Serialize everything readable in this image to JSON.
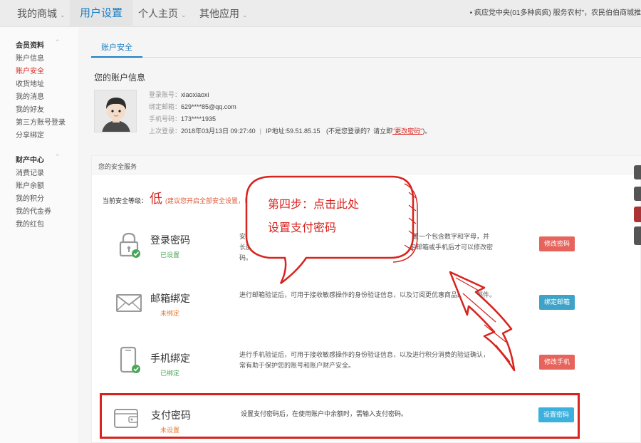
{
  "topnav": {
    "items": [
      {
        "label": "我的商城",
        "caret": "⌄"
      },
      {
        "label": "用户设置"
      },
      {
        "label": "个人主页",
        "caret": "⌄"
      },
      {
        "label": "其他应用",
        "caret": "⌄"
      }
    ],
    "notice": "• 疯应党中央(01多种疯疯) 服务农村\"，农民伯伯商城推"
  },
  "sidebar": {
    "group1": {
      "title": "会员资料",
      "fold": "⌃",
      "items": [
        "账户信息",
        "账户安全",
        "收货地址",
        "我的消息",
        "我的好友",
        "第三方账号登录",
        "分享绑定"
      ]
    },
    "group2": {
      "title": "财产中心",
      "fold": "⌃",
      "items": [
        "消费记录",
        "账户余额",
        "我的积分",
        "我的代金券",
        "我的红包"
      ]
    }
  },
  "main": {
    "tab": "账户安全",
    "info_title": "您的账户信息",
    "account": {
      "login_label": "登录账号：",
      "login_value": "xiaoxiaoxi",
      "email_label": "绑定邮箱：",
      "email_value": "629****85@qq.com",
      "phone_label": "手机号码：",
      "phone_value": "173****1935",
      "last_login_label": "上次登录：",
      "last_login_value": "2018年03月13日 09:27:40",
      "ip_sep": "|",
      "ip_label": "IP地址:",
      "ip_value": "59.51.85.15",
      "warn_pre": "(不是您登录的？请立即",
      "warn_link": "\"更改密码\"",
      "warn_post": ")。"
    },
    "security": {
      "head": "您的安全服务",
      "level_label": "当前安全等级：",
      "level_value": "低",
      "level_hint": "(建议您开启全部安全设置，以",
      "services": [
        {
          "name": "登录密码",
          "state": "已设置",
          "desc1": "安全性高的密码可以使账号更安全。建议您定期更换密码，设置一个包含数字和字母，并",
          "desc2": "长度超过6位以上的密码，为保证您的账户安全，只有在您绑定邮箱或手机后才可以修改密",
          "desc3": "码。",
          "button": "修改密码",
          "icon": "lock-icon"
        },
        {
          "name": "邮箱绑定",
          "state": "未绑定",
          "desc1": "进行邮箱验证后，可用于接收敏感操作的身份验证信息，以及订阅更优惠商品的促销邮件。",
          "button": "绑定邮箱",
          "icon": "envelope-icon"
        },
        {
          "name": "手机绑定",
          "state": "已绑定",
          "desc1": "进行手机验证后，可用于接收敏感操作的身份验证信息，以及进行积分消费的验证确认，",
          "desc2": "常有助于保护您的账号和账户财产安全。",
          "button": "修改手机",
          "icon": "phone-icon"
        }
      ],
      "pay": {
        "name": "支付密码",
        "state": "未设置",
        "desc": "设置支付密码后，在使用账户中余额时，需输入支付密码。",
        "button": "设置密码",
        "icon": "wallet-icon"
      }
    }
  },
  "callout": {
    "line1": "第四步：点击此处",
    "line2": "设置支付密码"
  },
  "colors": {
    "accent_blue": "#1a7fc4",
    "highlight_red": "#d8231e",
    "ok_green": "#4aa757",
    "warn_orange": "#e9782d"
  }
}
